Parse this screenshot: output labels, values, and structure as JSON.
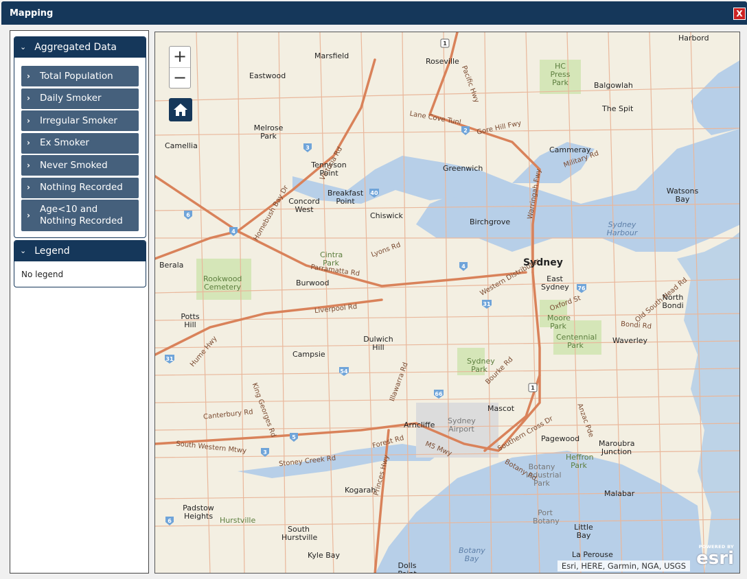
{
  "window": {
    "title": "Mapping",
    "close_label": "X"
  },
  "aggregated": {
    "header": "Aggregated Data",
    "items": [
      "Total Population",
      "Daily Smoker",
      "Irregular Smoker",
      "Ex Smoker",
      "Never Smoked",
      "Nothing Recorded",
      "Age<10 and Nothing Recorded"
    ]
  },
  "legend": {
    "header": "Legend",
    "body": "No legend"
  },
  "map": {
    "zoom_in": "+",
    "zoom_out": "−",
    "attribution": "Esri, HERE, Garmin, NGA, USGS",
    "powered_by": "POWERED BY",
    "esri_logo": "esri",
    "colors": {
      "land": "#f3efe2",
      "water": "#b7cfe8",
      "park": "#d5e6b8",
      "road": "#e69a72",
      "highway": "#d9825a"
    },
    "places": [
      "Harbord",
      "Marsfield",
      "Roseville",
      "HC Press Park",
      "Eastwood",
      "Balgowlah",
      "The Spit",
      "Melrose Park",
      "Camellia",
      "Tennyson Point",
      "Greenwich",
      "Cammeray",
      "Watsons Bay",
      "Breakfast Point",
      "Concord West",
      "Chiswick",
      "Birchgrove",
      "Sydney Harbour",
      "Cintra Park",
      "Sydney",
      "Berala",
      "East Sydney",
      "Rookwood Cemetery",
      "Burwood",
      "North Bondi",
      "Potts Hill",
      "Moore Park",
      "Centennial Park",
      "Waverley",
      "Dulwich Hill",
      "Campsie",
      "Sydney Park",
      "Mascot",
      "Sydney Airport",
      "Arncliffe",
      "Pagewood",
      "Maroubra Junction",
      "Heffron Park",
      "Botany Industrial Park",
      "Kogarah",
      "Malabar",
      "Padstow Heights",
      "Hurstville",
      "Port Botany",
      "South Hurstville",
      "Little Bay",
      "Botany Bay",
      "Kyle Bay",
      "La Perouse",
      "Dolls Point"
    ],
    "roads": [
      "Parramatta Rd",
      "Liverpool Rd",
      "Homebush Bay Dr",
      "Hume Hwy",
      "Canterbury Rd",
      "King Georges Rd",
      "Stoney Creek Rd",
      "Princes Hwy",
      "M5 Mwy",
      "Warringah Fwy",
      "Military Rd",
      "Pacific Hwy",
      "Lane Cove Tunl",
      "Gore Hill Fwy",
      "Western Distributor",
      "Southern Cross Dr",
      "Anzac Pde",
      "Botany Rd",
      "South Western Mtwy",
      "Victoria Rd",
      "Lyons Rd",
      "Old South Head Rd",
      "Bondi Rd",
      "Oxford St",
      "Forest Rd",
      "Illawarra Rd",
      "Bourke Rd"
    ],
    "route_shields": [
      "1",
      "2",
      "3",
      "4",
      "6",
      "31",
      "40",
      "54",
      "66",
      "76",
      "1",
      "2",
      "3",
      "4",
      "5",
      "6"
    ]
  }
}
